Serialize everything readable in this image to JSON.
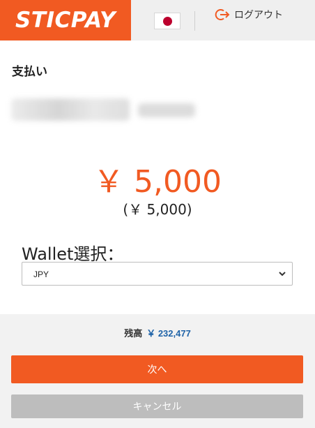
{
  "header": {
    "logo_text": "STICPAY",
    "language_flag": "japan-flag-icon",
    "logout_label": "ログアウト",
    "logout_icon": "logout-icon"
  },
  "payment": {
    "title": "支払い",
    "amount": "￥ 5,000",
    "amount_sub": "(￥ 5,000)",
    "wallet_label": "Wallet選択：",
    "wallet_selected": "JPY"
  },
  "footer": {
    "balance_label": "残高",
    "balance_amount": "￥ 232,477",
    "next_label": "次へ",
    "cancel_label": "キャンセル"
  },
  "colors": {
    "brand": "#f15a22",
    "balance_blue": "#1f63a8",
    "cancel_gray": "#bdbdbd"
  }
}
